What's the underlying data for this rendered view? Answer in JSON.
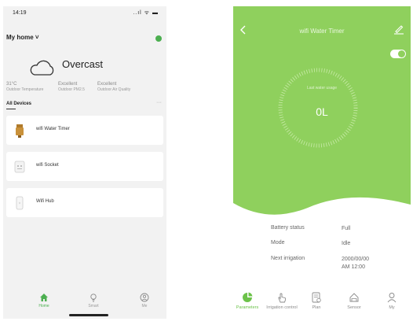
{
  "left_screen": {
    "status_time": "14:19",
    "status_icons": "..ıl ᯤ ▬",
    "home_title": "My home ˅",
    "weather": {
      "condition": "Overcast",
      "stats": [
        {
          "value": "31°C",
          "label": "Outdoor Temperature"
        },
        {
          "value": "Excellent",
          "label": "Outdoor PM2.5"
        },
        {
          "value": "Excellent",
          "label": "Outdoor Air Quality"
        }
      ]
    },
    "devices_title": "All Devices",
    "devices_more": "···",
    "devices": [
      {
        "name": "wifi Water Timer",
        "icon": "water-timer-icon"
      },
      {
        "name": "wifi Socket",
        "icon": "socket-icon"
      },
      {
        "name": "Wifi Hub",
        "icon": "hub-icon"
      }
    ],
    "tabs": [
      {
        "label": "Home",
        "icon": "home-icon",
        "active": true
      },
      {
        "label": "Smart",
        "icon": "smart-icon",
        "active": false
      },
      {
        "label": "Me",
        "icon": "me-icon",
        "active": false
      }
    ],
    "accent_color": "#4caf50"
  },
  "right_screen": {
    "title": "wifi Water Timer",
    "ring_label": "Last water usage",
    "ring_value": "0L",
    "hero_color": "#8fd05d",
    "info": [
      {
        "label": "Battery status",
        "value": "Full"
      },
      {
        "label": "Mode",
        "value": "Idle"
      },
      {
        "label": "Next irrigation",
        "value": "2000/00/00",
        "value2": "AM 12:00"
      }
    ],
    "tabs": [
      {
        "label": "Parameters",
        "icon": "pie-chart-icon",
        "active": true
      },
      {
        "label": "Irrigation control",
        "icon": "hand-tap-icon",
        "active": false
      },
      {
        "label": "Plan",
        "icon": "plan-icon",
        "active": false
      },
      {
        "label": "Sensor",
        "icon": "sensor-icon",
        "active": false
      },
      {
        "label": "My",
        "icon": "person-icon",
        "active": false
      }
    ]
  }
}
